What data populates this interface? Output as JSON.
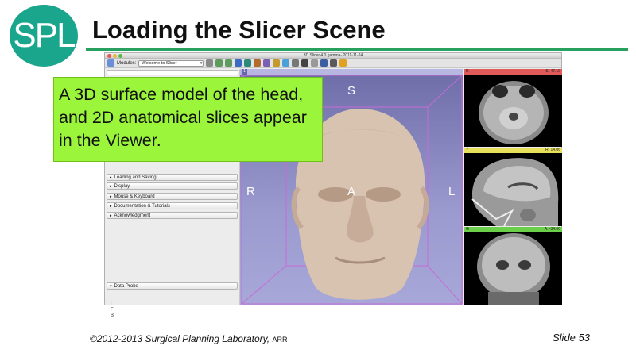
{
  "slide": {
    "logo_text": "SPL",
    "title": "Loading the Slicer Scene",
    "footer_copyright": "©2012-2013 Surgical Planning Laboratory,",
    "footer_rights": "ARR",
    "slide_number": "Slide 53",
    "colors": {
      "logo": "#1aa68c",
      "rule": "#27a060",
      "callout": "#9bf53b"
    }
  },
  "callout": {
    "text": "A 3D surface model of the head, and 2D anatomical slices appear in the Viewer."
  },
  "slicer": {
    "window_title": "3D Slicer 4.0.gamma- 2011-11-24",
    "toolbar": {
      "modules_label": "Modules:",
      "module_selected": "Welcome to Slicer"
    },
    "panel_sections": [
      "Loading and Saving",
      "Display",
      "Mouse & Keyboard",
      "Documentation & Tutorials",
      "Acknowledgment"
    ],
    "data_probe_label": "Data Probe",
    "data_probe_coords": "L\nF\nB",
    "view3d": {
      "pin_label": "1",
      "orientation": {
        "top": "S",
        "left": "R",
        "center": "A",
        "right": "L"
      }
    },
    "slices": [
      {
        "name": "R",
        "value": "S: 47.19",
        "color": "#e05a5a"
      },
      {
        "name": "Y",
        "value": "R: 14.06",
        "color": "#e8e05a"
      },
      {
        "name": "G",
        "value": "A: -34.60",
        "color": "#6ccf4a"
      }
    ]
  }
}
